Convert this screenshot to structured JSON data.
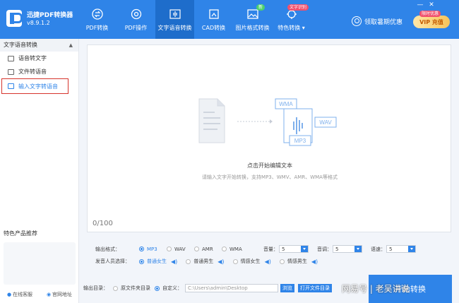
{
  "app": {
    "name": "迅捷PDF转换器",
    "version": "v8.9.1.2"
  },
  "nav": [
    {
      "label": "PDF转换",
      "icon": "swap-circle-icon",
      "active": false,
      "badge": ""
    },
    {
      "label": "PDF操作",
      "icon": "gear-icon",
      "active": false,
      "badge": ""
    },
    {
      "label": "文字语音转换",
      "icon": "soundwave-icon",
      "active": true,
      "badge": ""
    },
    {
      "label": "CAD转换",
      "icon": "image-frame-icon",
      "active": false,
      "badge": ""
    },
    {
      "label": "图片格式转换",
      "icon": "picture-icon",
      "active": false,
      "badge": "新"
    },
    {
      "label": "特色转换 ▾",
      "icon": "sparkle-gear-icon",
      "active": false,
      "badge": "文字识别"
    }
  ],
  "header": {
    "promo": "领取暑期优惠",
    "vip": "VIP 充值",
    "vip_tag": "限时优惠",
    "win_min": "—",
    "win_close": "✕"
  },
  "sidebar": {
    "section": "文字语音转换",
    "items": [
      {
        "label": "语音转文字",
        "active": false
      },
      {
        "label": "文件转语音",
        "active": false
      },
      {
        "label": "输入文字转语音",
        "active": true
      }
    ],
    "featured_title": "特色产品推荐",
    "footer": [
      {
        "label": "在线客服"
      },
      {
        "label": "官网地址"
      }
    ]
  },
  "editor": {
    "hint_title": "点击开始编辑文本",
    "hint_sub": "请输入文字开始转换，支持MP3、WMV、AMR、WMA等格式",
    "count": "0/100",
    "formats": [
      "WMA",
      "WAV",
      "MP3"
    ]
  },
  "settings": {
    "format_label": "输出格式：",
    "formats": [
      {
        "label": "MP3",
        "on": true
      },
      {
        "label": "WAV",
        "on": false
      },
      {
        "label": "AMR",
        "on": false
      },
      {
        "label": "WMA",
        "on": false
      }
    ],
    "volume_label": "音量：",
    "volume": "5",
    "pitch_label": "音调：",
    "pitch": "5",
    "speed_label": "语速：",
    "speed": "5",
    "voice_label": "发音人员选择：",
    "voices": [
      {
        "label": "普通女生",
        "on": true
      },
      {
        "label": "普通男生",
        "on": false
      },
      {
        "label": "情感女生",
        "on": false
      },
      {
        "label": "情感男生",
        "on": false
      }
    ],
    "output_label": "输出目录：",
    "dir_original": "原文件夹目录",
    "dir_custom": "自定义：",
    "path": "C:\\Users\\admin\\Desktop",
    "browse": "浏览",
    "open_dir": "打开文件目录",
    "start": "开始转换"
  },
  "watermark": "网易号 | 老吴讲说",
  "colors": {
    "accent": "#2f84e8",
    "highlight": "#d6342c"
  }
}
